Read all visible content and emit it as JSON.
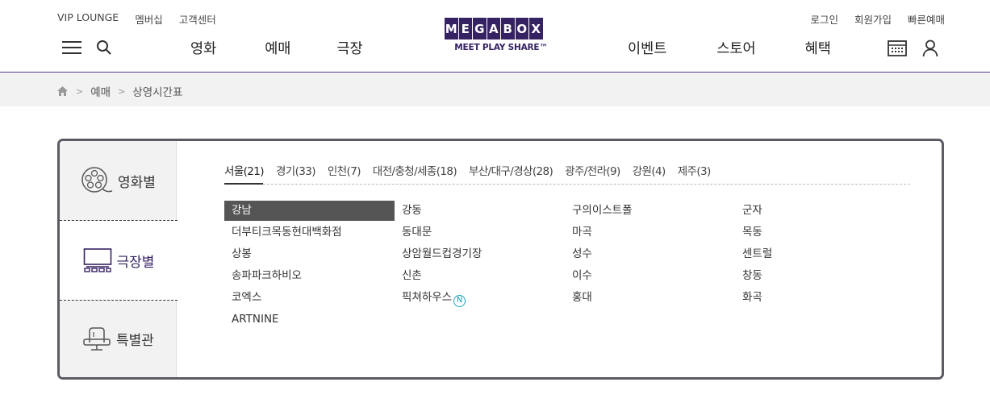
{
  "header": {
    "util_left": [
      "VIP LOUNGE",
      "멤버십",
      "고객센터"
    ],
    "util_right": [
      "로그인",
      "회원가입",
      "빠른예매"
    ],
    "gnb_left": [
      "영화",
      "예매",
      "극장"
    ],
    "gnb_right": [
      "이벤트",
      "스토어",
      "혜택"
    ],
    "logo_letters": [
      "M",
      "E",
      "G",
      "A",
      "B",
      "O",
      "X"
    ],
    "logo_tagline": "MEET PLAY SHARE™",
    "brand_color": "#352263"
  },
  "breadcrumb": {
    "items": [
      "예매",
      "상영시간표"
    ]
  },
  "side_tabs": [
    "영화별",
    "극장별",
    "특별관"
  ],
  "regions": [
    "서울(21)",
    "경기(33)",
    "인천(7)",
    "대전/충청/세종(18)",
    "부산/대구/경상(28)",
    "광주/전라(9)",
    "강원(4)",
    "제주(3)"
  ],
  "theaters": {
    "col1": [
      "강남",
      "더부티크목동현대백화점",
      "상봉",
      "송파파크하비오",
      "코엑스",
      "ARTNINE"
    ],
    "col2": [
      "강동",
      "동대문",
      "상암월드컵경기장",
      "신촌",
      "픽쳐하우스"
    ],
    "col3": [
      "구의이스트폴",
      "마곡",
      "성수",
      "이수",
      "홍대"
    ],
    "col4": [
      "군자",
      "목동",
      "센트럴",
      "창동",
      "화곡"
    ],
    "new_badge": "N"
  }
}
